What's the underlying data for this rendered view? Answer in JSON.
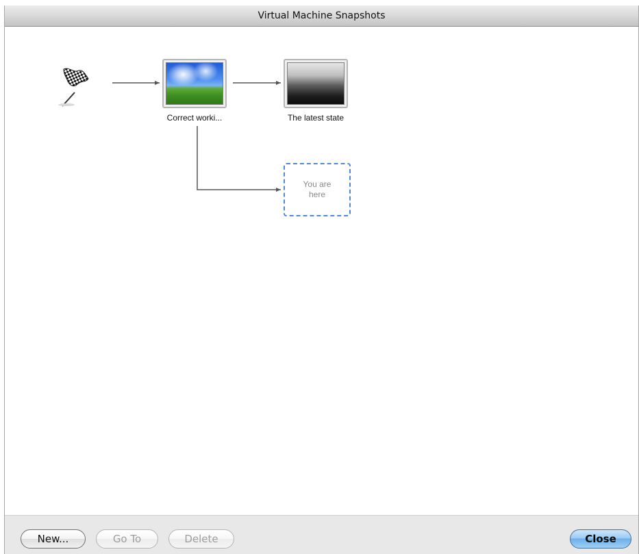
{
  "window": {
    "title": "Virtual Machine Snapshots"
  },
  "snapshots": {
    "start_icon": "checkered-flag-icon",
    "nodes": [
      {
        "label": "Correct worki...",
        "thumbnail": "windows-xp-bliss-desktop"
      },
      {
        "label": "The latest state",
        "thumbnail": "dark-gradient-screen"
      }
    ],
    "current": {
      "text": "You are here"
    }
  },
  "buttons": {
    "new": "New...",
    "goto": "Go To",
    "delete": "Delete",
    "close": "Close"
  },
  "colors": {
    "current_state_border": "#4f86d8",
    "default_button": "#6bb0ea"
  }
}
